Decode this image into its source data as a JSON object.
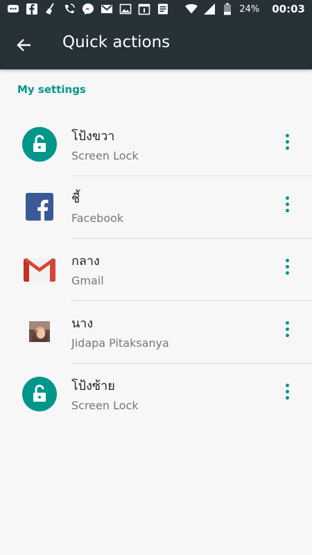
{
  "status_bar": {
    "battery_percent": "24%",
    "time": "00:03"
  },
  "app_bar": {
    "title": "Quick actions"
  },
  "section_header": "My settings",
  "items": [
    {
      "title": "โป้งขวา",
      "subtitle": "Screen Lock",
      "icon": "lock-open-icon",
      "icon_color": "#00968a"
    },
    {
      "title": "ชี้",
      "subtitle": "Facebook",
      "icon": "facebook-icon",
      "icon_color": "#3b5998"
    },
    {
      "title": "กลาง",
      "subtitle": "Gmail",
      "icon": "gmail-icon",
      "icon_color": "#d44638"
    },
    {
      "title": "นาง",
      "subtitle": "Jidapa Pitaksanya",
      "icon": "contact-photo",
      "icon_color": "#8d6e63"
    },
    {
      "title": "โป้งซ้าย",
      "subtitle": "Screen Lock",
      "icon": "lock-open-icon",
      "icon_color": "#00968a"
    }
  ],
  "colors": {
    "accent": "#00968a",
    "app_bar": "#263238",
    "background": "#f7f7f7"
  }
}
